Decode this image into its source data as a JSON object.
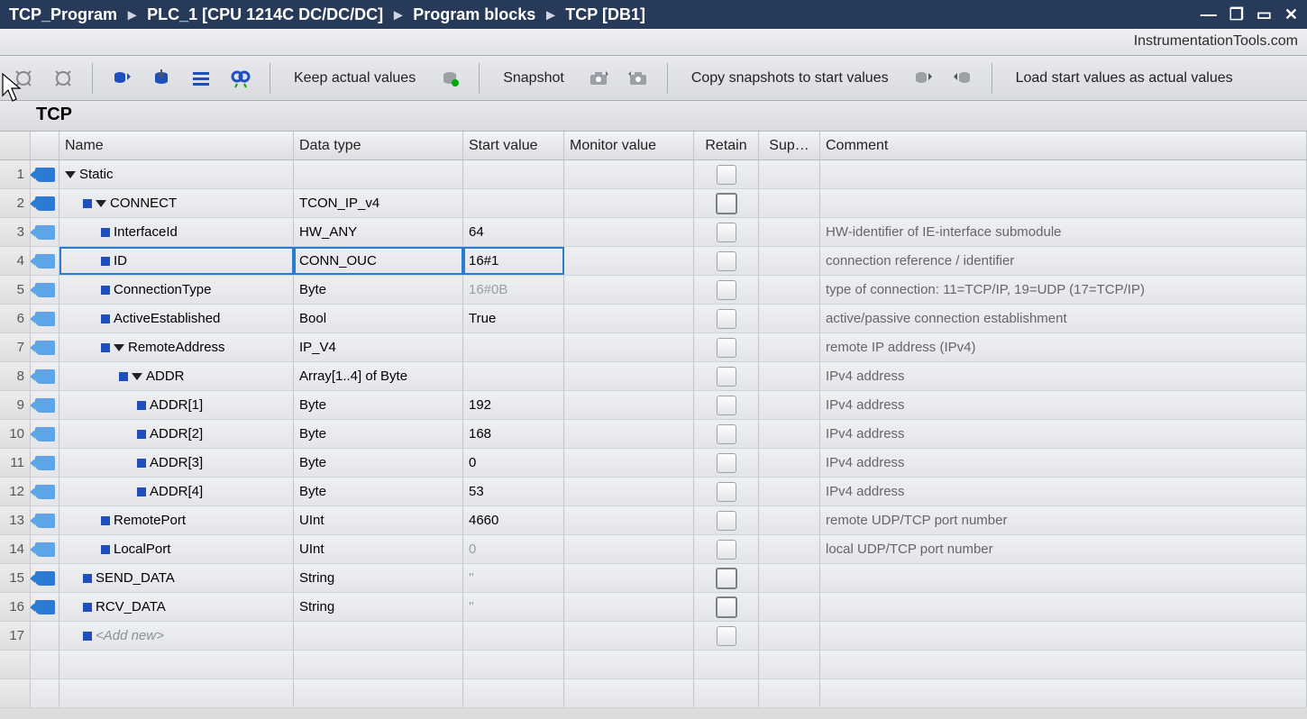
{
  "titlebar": {
    "crumbs": [
      "TCP_Program",
      "PLC_1 [CPU 1214C DC/DC/DC]",
      "Program blocks",
      "TCP [DB1]"
    ]
  },
  "watermark": "InstrumentationTools.com",
  "toolbar": {
    "keep_actual": "Keep actual values",
    "snapshot": "Snapshot",
    "copy_snapshots": "Copy snapshots to start values",
    "load_start": "Load start values as actual values"
  },
  "block_name": "TCP",
  "columns": {
    "name": "Name",
    "type": "Data type",
    "start": "Start value",
    "monitor": "Monitor value",
    "retain": "Retain",
    "setpoint": "Sup…",
    "comment": "Comment"
  },
  "rows": [
    {
      "n": "1",
      "tag": true,
      "indent": 1,
      "tri": true,
      "box": false,
      "name": "Static",
      "type": "",
      "start": "",
      "comm": "",
      "chk": "normal"
    },
    {
      "n": "2",
      "tag": true,
      "indent": 2,
      "tri": true,
      "box": true,
      "name": "CONNECT",
      "type": "TCON_IP_v4",
      "start": "",
      "comm": "",
      "chk": "strong"
    },
    {
      "n": "3",
      "tag": true,
      "tag_light": true,
      "indent": 3,
      "tri": false,
      "box": true,
      "name": "InterfaceId",
      "type": "HW_ANY",
      "start": "64",
      "comm": "HW-identifier of IE-interface submodule",
      "chk": "normal"
    },
    {
      "n": "4",
      "tag": true,
      "tag_light": true,
      "indent": 3,
      "tri": false,
      "box": true,
      "name": "ID",
      "type": "CONN_OUC",
      "start": "16#1",
      "comm": "connection reference / identifier",
      "chk": "normal",
      "selected": true
    },
    {
      "n": "5",
      "tag": true,
      "tag_light": true,
      "indent": 3,
      "tri": false,
      "box": true,
      "name": "ConnectionType",
      "type": "Byte",
      "start": "16#0B",
      "start_dim": true,
      "comm": "type of connection: 11=TCP/IP, 19=UDP (17=TCP/IP)",
      "chk": "normal"
    },
    {
      "n": "6",
      "tag": true,
      "tag_light": true,
      "indent": 3,
      "tri": false,
      "box": true,
      "name": "ActiveEstablished",
      "type": "Bool",
      "start": "True",
      "comm": "active/passive connection establishment",
      "chk": "normal"
    },
    {
      "n": "7",
      "tag": true,
      "tag_light": true,
      "indent": 3,
      "tri": true,
      "box": true,
      "name": "RemoteAddress",
      "type": "IP_V4",
      "start": "",
      "comm": "remote IP address (IPv4)",
      "chk": "normal"
    },
    {
      "n": "8",
      "tag": true,
      "tag_light": true,
      "indent": 4,
      "tri": true,
      "box": true,
      "name": "ADDR",
      "type": "Array[1..4] of Byte",
      "start": "",
      "comm": "IPv4 address",
      "chk": "normal"
    },
    {
      "n": "9",
      "tag": true,
      "tag_light": true,
      "indent": 5,
      "tri": false,
      "box": true,
      "name": "ADDR[1]",
      "type": "Byte",
      "start": "192",
      "comm": "IPv4 address",
      "chk": "normal"
    },
    {
      "n": "10",
      "tag": true,
      "tag_light": true,
      "indent": 5,
      "tri": false,
      "box": true,
      "name": "ADDR[2]",
      "type": "Byte",
      "start": "168",
      "comm": "IPv4 address",
      "chk": "normal"
    },
    {
      "n": "11",
      "tag": true,
      "tag_light": true,
      "indent": 5,
      "tri": false,
      "box": true,
      "name": "ADDR[3]",
      "type": "Byte",
      "start": "0",
      "comm": "IPv4 address",
      "chk": "normal"
    },
    {
      "n": "12",
      "tag": true,
      "tag_light": true,
      "indent": 5,
      "tri": false,
      "box": true,
      "name": "ADDR[4]",
      "type": "Byte",
      "start": "53",
      "comm": "IPv4 address",
      "chk": "normal"
    },
    {
      "n": "13",
      "tag": true,
      "tag_light": true,
      "indent": 3,
      "tri": false,
      "box": true,
      "name": "RemotePort",
      "type": "UInt",
      "start": "4660",
      "comm": "remote UDP/TCP port number",
      "chk": "normal"
    },
    {
      "n": "14",
      "tag": true,
      "tag_light": true,
      "indent": 3,
      "tri": false,
      "box": true,
      "name": "LocalPort",
      "type": "UInt",
      "start": "0",
      "start_dim": true,
      "comm": "local UDP/TCP port number",
      "chk": "normal"
    },
    {
      "n": "15",
      "tag": true,
      "indent": 2,
      "tri": false,
      "box": true,
      "name": "SEND_DATA",
      "type": "String",
      "start": "''",
      "start_dim": true,
      "comm": "",
      "chk": "strong"
    },
    {
      "n": "16",
      "tag": true,
      "indent": 2,
      "tri": false,
      "box": true,
      "name": "RCV_DATA",
      "type": "String",
      "start": "''",
      "start_dim": true,
      "comm": "",
      "chk": "strong"
    },
    {
      "n": "17",
      "tag": false,
      "indent": 2,
      "tri": false,
      "box": true,
      "name": "<Add new>",
      "name_ital": true,
      "type": "",
      "start": "",
      "comm": "",
      "chk": "normal"
    }
  ]
}
